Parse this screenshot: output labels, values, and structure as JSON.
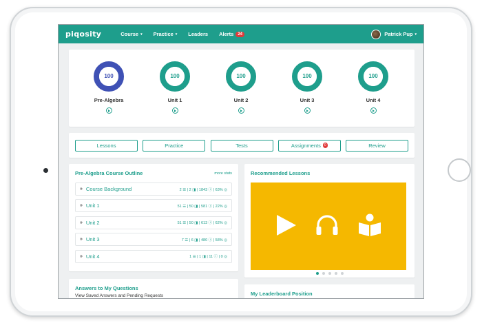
{
  "nav": {
    "brand": "piqosity",
    "items": [
      {
        "label": "Course",
        "caret": "▾"
      },
      {
        "label": "Practice",
        "caret": "▾"
      },
      {
        "label": "Leaders"
      },
      {
        "label": "Alerts",
        "badge": "24"
      }
    ],
    "user": {
      "name": "Patrick Pup",
      "caret": "▾"
    }
  },
  "progress": {
    "units": [
      {
        "name": "Pre-Algebra",
        "value": "100",
        "percent": 100,
        "color": "#3f51b5"
      },
      {
        "name": "Unit 1",
        "value": "100",
        "percent": 100,
        "color": "#1e9e8c"
      },
      {
        "name": "Unit 2",
        "value": "100",
        "percent": 100,
        "color": "#1e9e8c"
      },
      {
        "name": "Unit 3",
        "value": "100",
        "percent": 100,
        "color": "#1e9e8c"
      },
      {
        "name": "Unit 4",
        "value": "100",
        "percent": 100,
        "color": "#1e9e8c"
      }
    ]
  },
  "tabs": [
    {
      "label": "Lessons"
    },
    {
      "label": "Practice"
    },
    {
      "label": "Tests"
    },
    {
      "label": "Assignments",
      "badge": "0"
    },
    {
      "label": "Review"
    }
  ],
  "outline": {
    "title": "Pre-Algebra Course Outline",
    "more": "more stats",
    "rows": [
      {
        "label": "Course Background",
        "stats": "2 ☰ | 2 ◨ | 1843 ⓘ | 63% ◎"
      },
      {
        "label": "Unit 1",
        "stats": "51 ☰ | 50 ◨ | 581 ⓘ | 22% ◎"
      },
      {
        "label": "Unit 2",
        "stats": "51 ☰ | 50 ◨ | 613 ⓘ | 62% ◎"
      },
      {
        "label": "Unit 3",
        "stats": "7 ☰ | 6 ◨ | 480 ⓘ | 58% ◎"
      },
      {
        "label": "Unit 4",
        "stats": "1 ☰ | 1 ◨ | 11 ⓘ | 0 ◎"
      }
    ]
  },
  "recommended": {
    "title": "Recommended Lessons",
    "banner_color": "#f5b800",
    "icons": [
      "play-icon",
      "headphones-icon",
      "reading-icon"
    ]
  },
  "answers": {
    "title": "Answers to My Questions",
    "subtitle": "View Saved Answers and Pending Requests"
  },
  "leaderboard": {
    "title": "My Leaderboard Position"
  }
}
